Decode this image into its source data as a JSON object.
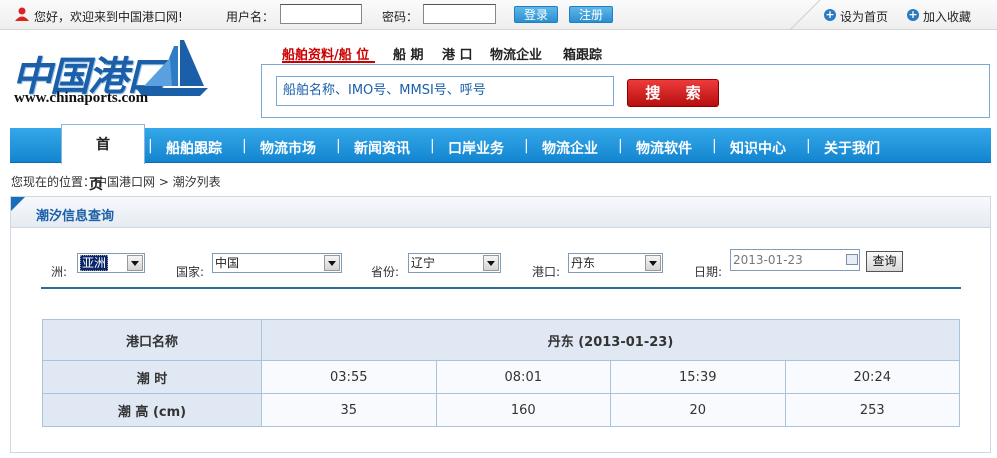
{
  "topbar": {
    "welcome": "您好，欢迎来到中国港口网!",
    "username_label": "用户名：",
    "username_value": "",
    "password_label": "密码：",
    "password_value": "",
    "login": "登录",
    "register": "注册",
    "set_home": "设为首页",
    "add_favorite": "加入收藏"
  },
  "logo": {
    "cn": "中国港口",
    "url": "www.chinaports.com"
  },
  "search": {
    "tabs": [
      "船舶资料/船 位",
      "船 期",
      "港 口",
      "物流企业",
      "箱跟踪"
    ],
    "placeholder": "船舶名称、IMO号、MMSI号、呼号",
    "button": "搜 索"
  },
  "nav": {
    "home": "首 页",
    "items": [
      "船舶跟踪",
      "物流市场",
      "新闻资讯",
      "口岸业务",
      "物流企业",
      "物流软件",
      "知识中心",
      "关于我们"
    ]
  },
  "breadcrumb": "您现在的位置：中国港口网 > 潮汐列表",
  "panel": {
    "title": "潮汐信息查询"
  },
  "filters": {
    "continent_label": "洲:",
    "continent": "亚洲",
    "country_label": "国家:",
    "country": "中国",
    "province_label": "省份:",
    "province": "辽宁",
    "port_label": "港口:",
    "port": "丹东",
    "date_label": "日期:",
    "date": "2013-01-23",
    "query": "查询"
  },
  "tide_table": {
    "port_header": "港口名称",
    "port_title": "丹东 (2013-01-23)",
    "time_label": "潮 时",
    "height_label": "潮 高 (cm)",
    "times": [
      "03:55",
      "08:01",
      "15:39",
      "20:24"
    ],
    "heights": [
      "35",
      "160",
      "20",
      "253"
    ]
  },
  "colors": {
    "nav_blue": "#1e96de",
    "search_red": "#d01c1c",
    "title_blue": "#1a5fa8"
  }
}
